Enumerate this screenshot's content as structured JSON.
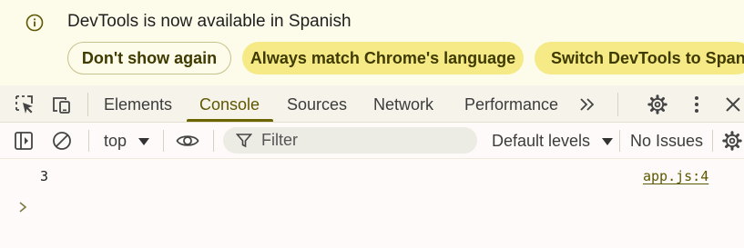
{
  "infobar": {
    "message": "DevTools is now available in Spanish",
    "icon": "info-icon",
    "buttons": {
      "dont_show": "Don't show again",
      "match_language": "Always match Chrome's language",
      "switch": "Switch DevTools to Spanis"
    }
  },
  "toolbar": {
    "tabs": [
      "Elements",
      "Console",
      "Sources",
      "Network",
      "Performance"
    ],
    "active_tab": "Console",
    "more_tabs_glyph": "»"
  },
  "console_toolbar": {
    "context": "top",
    "filter_placeholder": "Filter",
    "levels": "Default levels",
    "issues": "No Issues"
  },
  "output": {
    "entries": [
      {
        "value": "3",
        "source": "app.js:4"
      }
    ]
  },
  "colors": {
    "accent": "#6b6400",
    "infobar_bg": "#fdfbe9",
    "pill_fill": "#f5ea86",
    "toolbar_bg": "#f6f3ea"
  }
}
